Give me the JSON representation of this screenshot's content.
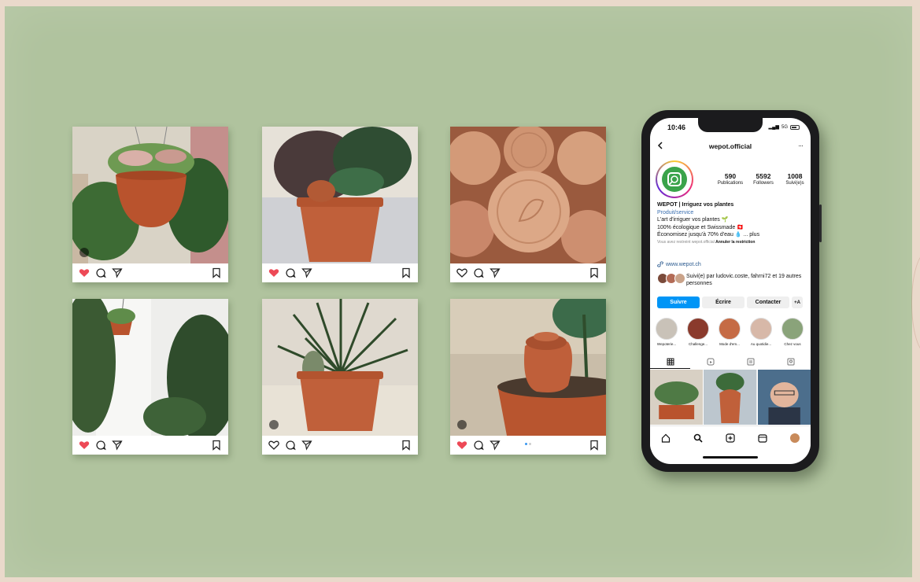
{
  "posts": [
    {
      "liked": true,
      "multi": true
    },
    {
      "liked": true,
      "multi": false
    },
    {
      "liked": false,
      "multi": false
    },
    {
      "liked": true,
      "multi": false
    },
    {
      "liked": false,
      "multi": true
    },
    {
      "liked": true,
      "multi": true,
      "carousel": true
    }
  ],
  "phone": {
    "status": {
      "time": "10:46",
      "signal": "5G"
    },
    "profile": {
      "username": "wepot.official",
      "more": "···",
      "stats": [
        {
          "value": "590",
          "label": "Publications"
        },
        {
          "value": "5592",
          "label": "Followers"
        },
        {
          "value": "1008",
          "label": "Suivi(e)s"
        }
      ],
      "bio": {
        "name": "WEPOT | Irriguez vos plantes",
        "category": "Produit/service",
        "line1": "L'art d'irriguer vos plantes 🌱",
        "line2": "100% écologique et Swissmade 🇨🇭",
        "line3": "Économisez jusqu'à 70% d'eau 💧 ... plus",
        "restrict_note": "Vous avez restreint wepot.official",
        "restrict_action": "Annuler la restriction"
      },
      "website": "www.wepot.ch",
      "followed_by": "Suivi(e) par ludovic.coste, fahrni72 et 19 autres personnes",
      "buttons": {
        "follow": "Suivre",
        "message": "Écrire",
        "contact": "Contacter",
        "add": "+A"
      },
      "highlights": [
        "Wepoterie...",
        "Challenge...",
        "Mode d'em...",
        "Au quotidie...",
        "Chez vous"
      ]
    }
  },
  "colors": {
    "background": "#b0c39e",
    "frame": "#ead9cb",
    "like_red": "#ed4956",
    "follow_blue": "#0095f6",
    "logo_green": "#3aa34a",
    "terracotta": "#c0603a"
  }
}
